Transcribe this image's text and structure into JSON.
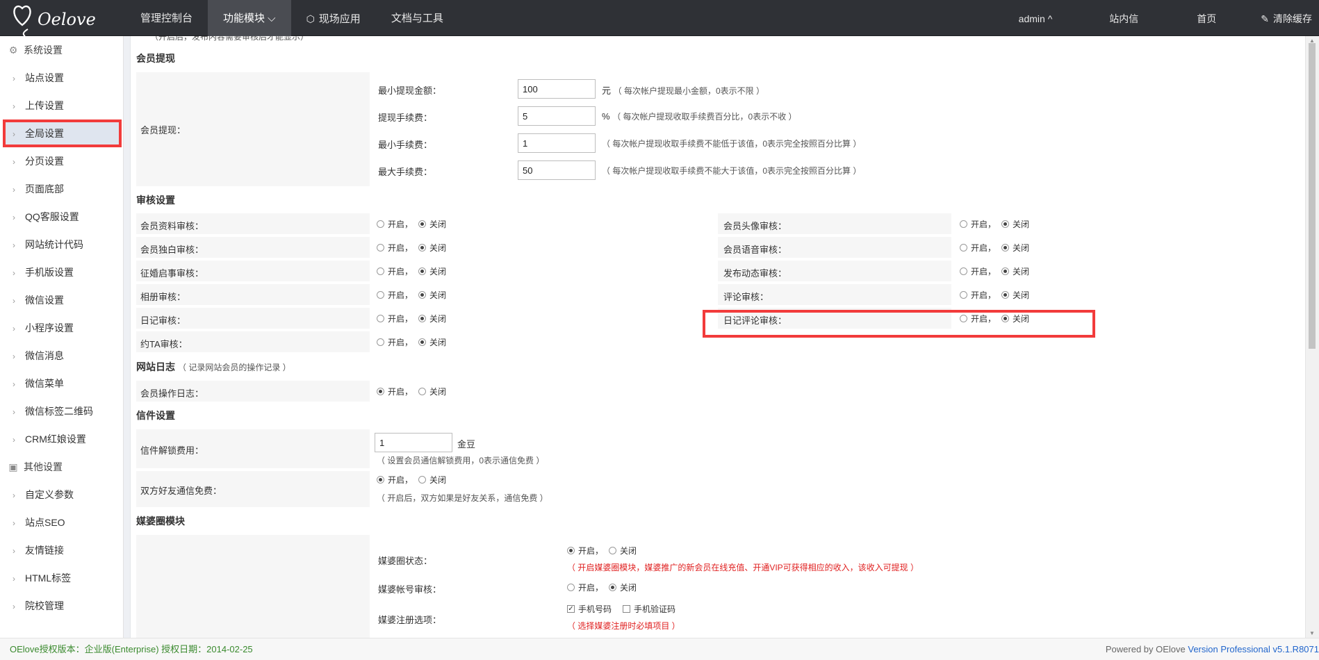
{
  "header": {
    "logo_text": "Oelove",
    "nav": [
      {
        "label": "管理控制台"
      },
      {
        "label": "功能模块 ⌵"
      },
      {
        "label": "现场应用"
      },
      {
        "label": "文档与工具"
      }
    ],
    "right": {
      "admin": "admin ^",
      "message": "站内信",
      "home": "首页",
      "clear_cache": "清除缓存"
    }
  },
  "sidebar": {
    "group1": "系统设置",
    "items1": [
      "站点设置",
      "上传设置",
      "全局设置",
      "分页设置",
      "页面底部",
      "QQ客服设置",
      "网站统计代码",
      "手机版设置",
      "微信设置",
      "小程序设置",
      "微信消息",
      "微信菜单",
      "微信标签二维码",
      "CRM红娘设置"
    ],
    "group2": "其他设置",
    "items2": [
      "自定义参数",
      "站点SEO",
      "友情链接",
      "HTML标签",
      "院校管理"
    ],
    "active_index": 2
  },
  "content": {
    "top_cut_text": "（开启后，发布内容需要审核后才能显示）",
    "withdraw": {
      "title": "会员提现",
      "row_label": "会员提现：",
      "fields": [
        {
          "label": "最小提现金额：",
          "value": "100",
          "unit": "元",
          "note": "（ 每次帐户提现最小金额，0表示不限 ）"
        },
        {
          "label": "提现手续费：",
          "value": "5",
          "unit": "%",
          "note": "（ 每次帐户提现收取手续费百分比，0表示不收 ）"
        },
        {
          "label": "最小手续费：",
          "value": "1",
          "unit": "",
          "note": "（ 每次帐户提现收取手续费不能低于该值，0表示完全按照百分比算 ）"
        },
        {
          "label": "最大手续费：",
          "value": "50",
          "unit": "",
          "note": "（ 每次帐户提现收取手续费不能大于该值，0表示完全按照百分比算 ）"
        }
      ]
    },
    "audit": {
      "title": "审核设置",
      "on": "开启，",
      "off": "关闭",
      "left": [
        "会员资料审核：",
        "会员独白审核：",
        "征婚启事审核：",
        "相册审核：",
        "日记审核：",
        "约TA审核："
      ],
      "right": [
        "会员头像审核：",
        "会员语音审核：",
        "发布动态审核：",
        "评论审核：",
        "日记评论审核："
      ]
    },
    "log": {
      "title": "网站日志",
      "title_note": "（ 记录网站会员的操作记录 ）",
      "row_label": "会员操作日志：",
      "on": "开启，",
      "off": "关闭"
    },
    "letter": {
      "title": "信件设置",
      "unlock_label": "信件解锁费用：",
      "unlock_value": "1",
      "unlock_unit": "金豆",
      "unlock_note": "（ 设置会员通信解锁费用，0表示通信免费 ）",
      "friends_label": "双方好友通信免费：",
      "on": "开启，",
      "off": "关闭",
      "friends_note": "（ 开启后，双方如果是好友关系，通信免费 ）"
    },
    "matchmaker": {
      "title": "媒婆圈模块",
      "status_label": "媒婆圈状态：",
      "on": "开启，",
      "off": "关闭",
      "status_note": "（ 开启媒婆圈模块，媒婆推广的新会员在线充值、开通VIP可获得相应的收入，该收入可提现 ）",
      "account_label": "媒婆帐号审核：",
      "reg_label": "媒婆注册选项：",
      "reg_opt1": "手机号码",
      "reg_opt2": "手机验证码",
      "reg_note": "（ 选择媒婆注册时必填项目 ）"
    }
  },
  "footer": {
    "left": "OElove授权版本：企业版(Enterprise) 授权日期：2014-02-25",
    "right_prefix": "Powered by OElove ",
    "right_version": "Version Professional v5.1.R8071"
  },
  "colors": {
    "topbar": "#2f3136",
    "highlight": "#f23b3b",
    "footer_left": "#3a8a2e",
    "footer_version": "#2266cc",
    "red_note": "#e02020"
  }
}
